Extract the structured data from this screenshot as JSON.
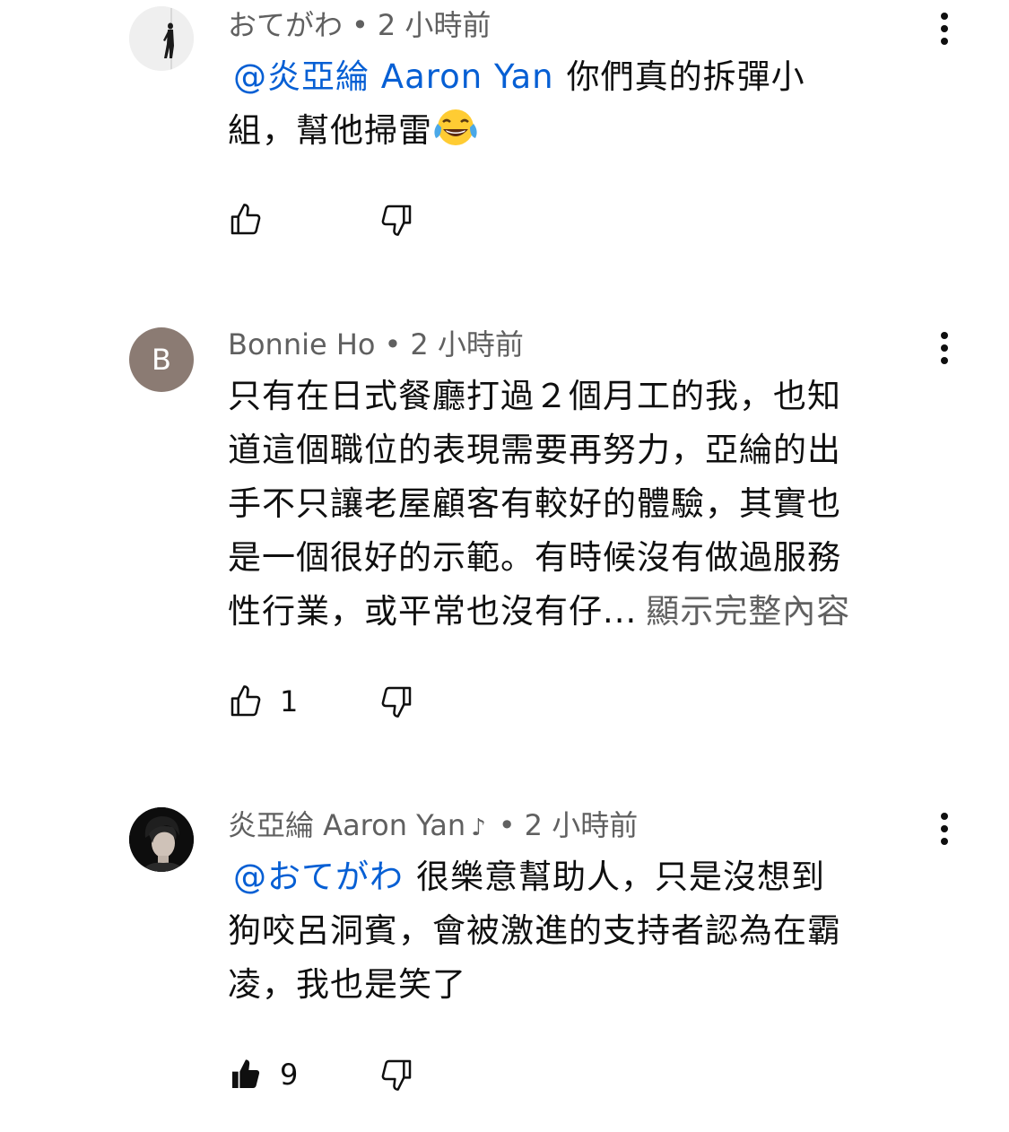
{
  "comments": [
    {
      "author": "おてがわ",
      "time": "2 小時前",
      "mention": "@炎亞綸 Aaron Yan",
      "text_line1": "你們真的拆彈小",
      "text_line2": "組，幫他掃雷",
      "emoji": "face-with-tears-of-joy",
      "likes": ""
    },
    {
      "author": "Bonnie Ho",
      "avatar_letter": "B",
      "time": "2 小時前",
      "lines": [
        "只有在日式餐廳打過２個月工的我，也知",
        "道這個職位的表現需要再努力，亞綸的出",
        "手不只讓老屋顧客有較好的體驗，其實也",
        "是一個很好的示範。有時候沒有做過服務",
        "性行業，或平常也沒有仔..."
      ],
      "show_more": "顯示完整內容",
      "likes": "1"
    },
    {
      "author": "炎亞綸 Aaron Yan",
      "badge": "♪",
      "time": "2 小時前",
      "mention": "@おてがわ",
      "text_line1": "很樂意幫助人，只是沒想到",
      "lines": [
        "狗咬呂洞賓，會被激進的支持者認為在霸",
        "凌，我也是笑了"
      ],
      "likes": "9",
      "liked": true
    }
  ],
  "separator": "•",
  "colors": {
    "mention": "#065fd4",
    "meta": "#606060",
    "text": "#0f0f0f",
    "avatar_b": "#8b7b73"
  },
  "icons": [
    "thumb-up-outline-icon",
    "thumb-down-outline-icon",
    "thumb-up-filled-icon",
    "more-vert-icon"
  ]
}
